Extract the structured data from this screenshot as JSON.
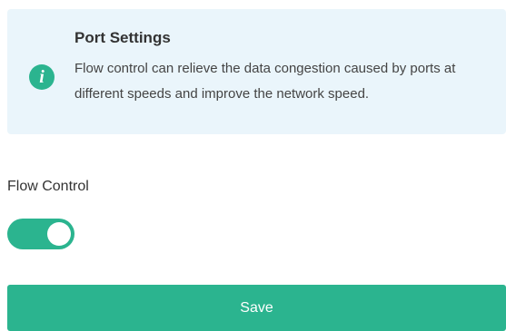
{
  "info": {
    "icon": "info-icon",
    "icon_glyph": "i",
    "title": "Port Settings",
    "text": "Flow control can relieve the data congestion caused by ports at different speeds and improve the network speed."
  },
  "flow_control": {
    "label": "Flow Control",
    "enabled": true
  },
  "actions": {
    "save_label": "Save"
  },
  "colors": {
    "accent": "#2bb48f",
    "info_background": "#eaf5fb"
  }
}
